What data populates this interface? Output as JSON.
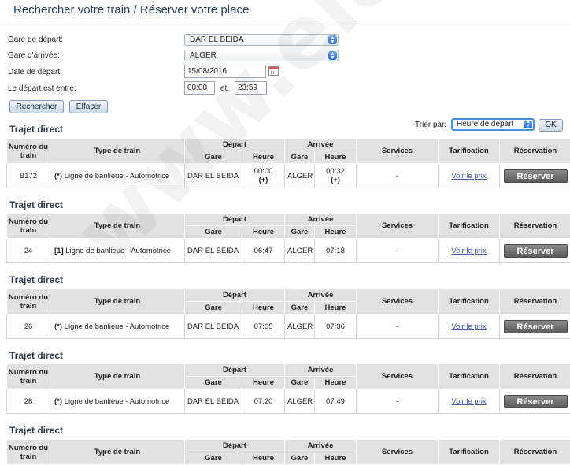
{
  "header": {
    "title": "Rechercher votre train / Réserver votre place"
  },
  "form": {
    "departure_label": "Gare de départ:",
    "departure_value": "DAR EL BEIDA",
    "arrival_label": "Gare d'arrivée:",
    "arrival_value": "ALGER",
    "date_label": "Date de départ:",
    "date_value": "15/08/2016",
    "time_label": "Le départ est entre:",
    "time_from": "00:00",
    "time_and": "et:",
    "time_to": "23:59",
    "search_button": "Rechercher",
    "clear_button": "Effacer"
  },
  "sort": {
    "label": "Trier par:",
    "value": "Heure de départ",
    "ok_button": "OK"
  },
  "table_headers": {
    "train_number": "Numéro du train",
    "train_type": "Type de train",
    "departure": "Départ",
    "arrival": "Arrivée",
    "station": "Gare",
    "time": "Heure",
    "services": "Services",
    "pricing": "Tarification",
    "reservation": "Réservation"
  },
  "sections": [
    {
      "title": "Trajet direct",
      "number": "B172",
      "code": "(*)",
      "type": "Ligne de banlieue - Automotrice",
      "dep_station": "DAR EL BEIDA",
      "dep_time": "00:00",
      "dep_suffix": "(+)",
      "arr_station": "ALGER",
      "arr_time": "00:32",
      "arr_suffix": "(+)",
      "services": "-",
      "price_link": "Voir le prix",
      "reserve_label": "Réserver"
    },
    {
      "title": "Trajet direct",
      "number": "24",
      "code": "[1]",
      "type": "Ligne de banlieue - Automotrice",
      "dep_station": "DAR EL BEIDA",
      "dep_time": "06:47",
      "dep_suffix": "",
      "arr_station": "ALGER",
      "arr_time": "07:18",
      "arr_suffix": "",
      "services": "-",
      "price_link": "Voir le prix",
      "reserve_label": "Réserver"
    },
    {
      "title": "Trajet direct",
      "number": "26",
      "code": "(*)",
      "type": "Ligne de banlieue - Automotrice",
      "dep_station": "DAR EL BEIDA",
      "dep_time": "07:05",
      "dep_suffix": "",
      "arr_station": "ALGER",
      "arr_time": "07:36",
      "arr_suffix": "",
      "services": "-",
      "price_link": "Voir le prix",
      "reserve_label": "Réserver"
    },
    {
      "title": "Trajet direct",
      "number": "28",
      "code": "(*)",
      "type": "Ligne de banlieue - Automotrice",
      "dep_station": "DAR EL BEIDA",
      "dep_time": "07:20",
      "dep_suffix": "",
      "arr_station": "ALGER",
      "arr_time": "07:49",
      "arr_suffix": "",
      "services": "-",
      "price_link": "Voir le prix",
      "reserve_label": "Réserver"
    },
    {
      "title": "Trajet direct"
    }
  ],
  "watermark": "www.electrodz.com",
  "colors": {
    "title": "#27415e",
    "header_bg": "#e1e1e1",
    "link": "#3a5fa5",
    "reserve_btn": "#6b6b6b",
    "select_accent": "#2c6fd1"
  }
}
